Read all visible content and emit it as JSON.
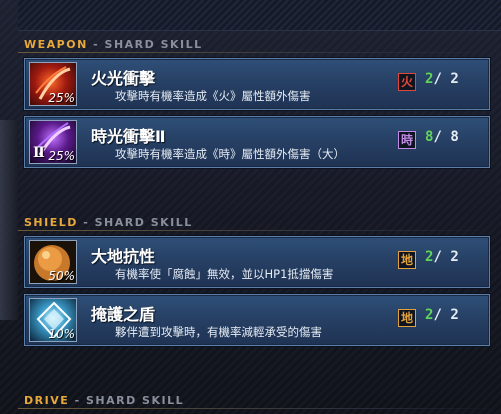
{
  "sections": {
    "weapon": {
      "title": "WEAPON",
      "sub": "- SHARD SKILL"
    },
    "shield": {
      "title": "SHIELD",
      "sub": "- SHARD SKILL"
    },
    "drive": {
      "title": "DRIVE",
      "sub": "- SHARD SKILL"
    }
  },
  "weapon_skills": [
    {
      "name": "火光衝擊",
      "description": "攻擊時有機率造成《火》屬性額外傷害",
      "rate": "25%",
      "element": "火",
      "element_color": "#e0463a",
      "current": "2",
      "sep": "/",
      "max": "2",
      "icon": "fire-slash-icon"
    },
    {
      "name": "時光衝擊Ⅱ",
      "description": "攻擊時有機率造成《時》屬性額外傷害（大）",
      "rate": "25%",
      "roman": "Ⅱ",
      "element": "時",
      "element_color": "#c28ae6",
      "current": "8",
      "sep": "/",
      "max": "8",
      "icon": "time-slash-icon"
    }
  ],
  "shield_skills": [
    {
      "name": "大地抗性",
      "description": "有機率使「腐蝕」無效，並以HP1抵擋傷害",
      "rate": "50%",
      "element": "地",
      "element_color": "#e3a13b",
      "current": "2",
      "sep": "/",
      "max": "2",
      "icon": "earth-orb-icon"
    },
    {
      "name": "掩護之盾",
      "description": "夥伴遭到攻擊時，有機率減輕承受的傷害",
      "rate": "10%",
      "element": "地",
      "element_color": "#e3a13b",
      "current": "2",
      "sep": "/",
      "max": "2",
      "icon": "crystal-shield-icon"
    }
  ]
}
